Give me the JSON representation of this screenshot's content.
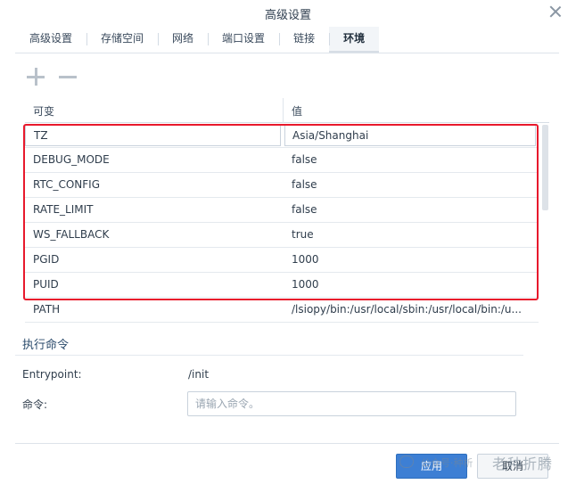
{
  "window": {
    "title": "高级设置"
  },
  "tabs": [
    {
      "label": "高级设置"
    },
    {
      "label": "存储空间"
    },
    {
      "label": "网络"
    },
    {
      "label": "端口设置"
    },
    {
      "label": "链接"
    },
    {
      "label": "环境",
      "active": true
    }
  ],
  "table": {
    "col_variable": "可变",
    "col_value": "值",
    "rows": [
      {
        "name": "TZ",
        "value": "Asia/Shanghai"
      },
      {
        "name": "DEBUG_MODE",
        "value": "false"
      },
      {
        "name": "RTC_CONFIG",
        "value": "false"
      },
      {
        "name": "RATE_LIMIT",
        "value": "false"
      },
      {
        "name": "WS_FALLBACK",
        "value": "true"
      },
      {
        "name": "PGID",
        "value": "1000"
      },
      {
        "name": "PUID",
        "value": "1000"
      },
      {
        "name": "PATH",
        "value": "/lsiopy/bin:/usr/local/sbin:/usr/local/bin:/u..."
      }
    ]
  },
  "exec": {
    "section_title": "执行命令",
    "entrypoint_label": "Entrypoint:",
    "entrypoint_value": "/init",
    "command_label": "命令:",
    "command_placeholder": "请输入命令。"
  },
  "footer": {
    "apply_label": "应用",
    "cancel_label": "取消"
  },
  "watermark": {
    "small_text": "公众号·种析",
    "big_text": "老种折腾"
  },
  "colors": {
    "accent": "#3d7fd4",
    "highlight": "#e8192c"
  }
}
